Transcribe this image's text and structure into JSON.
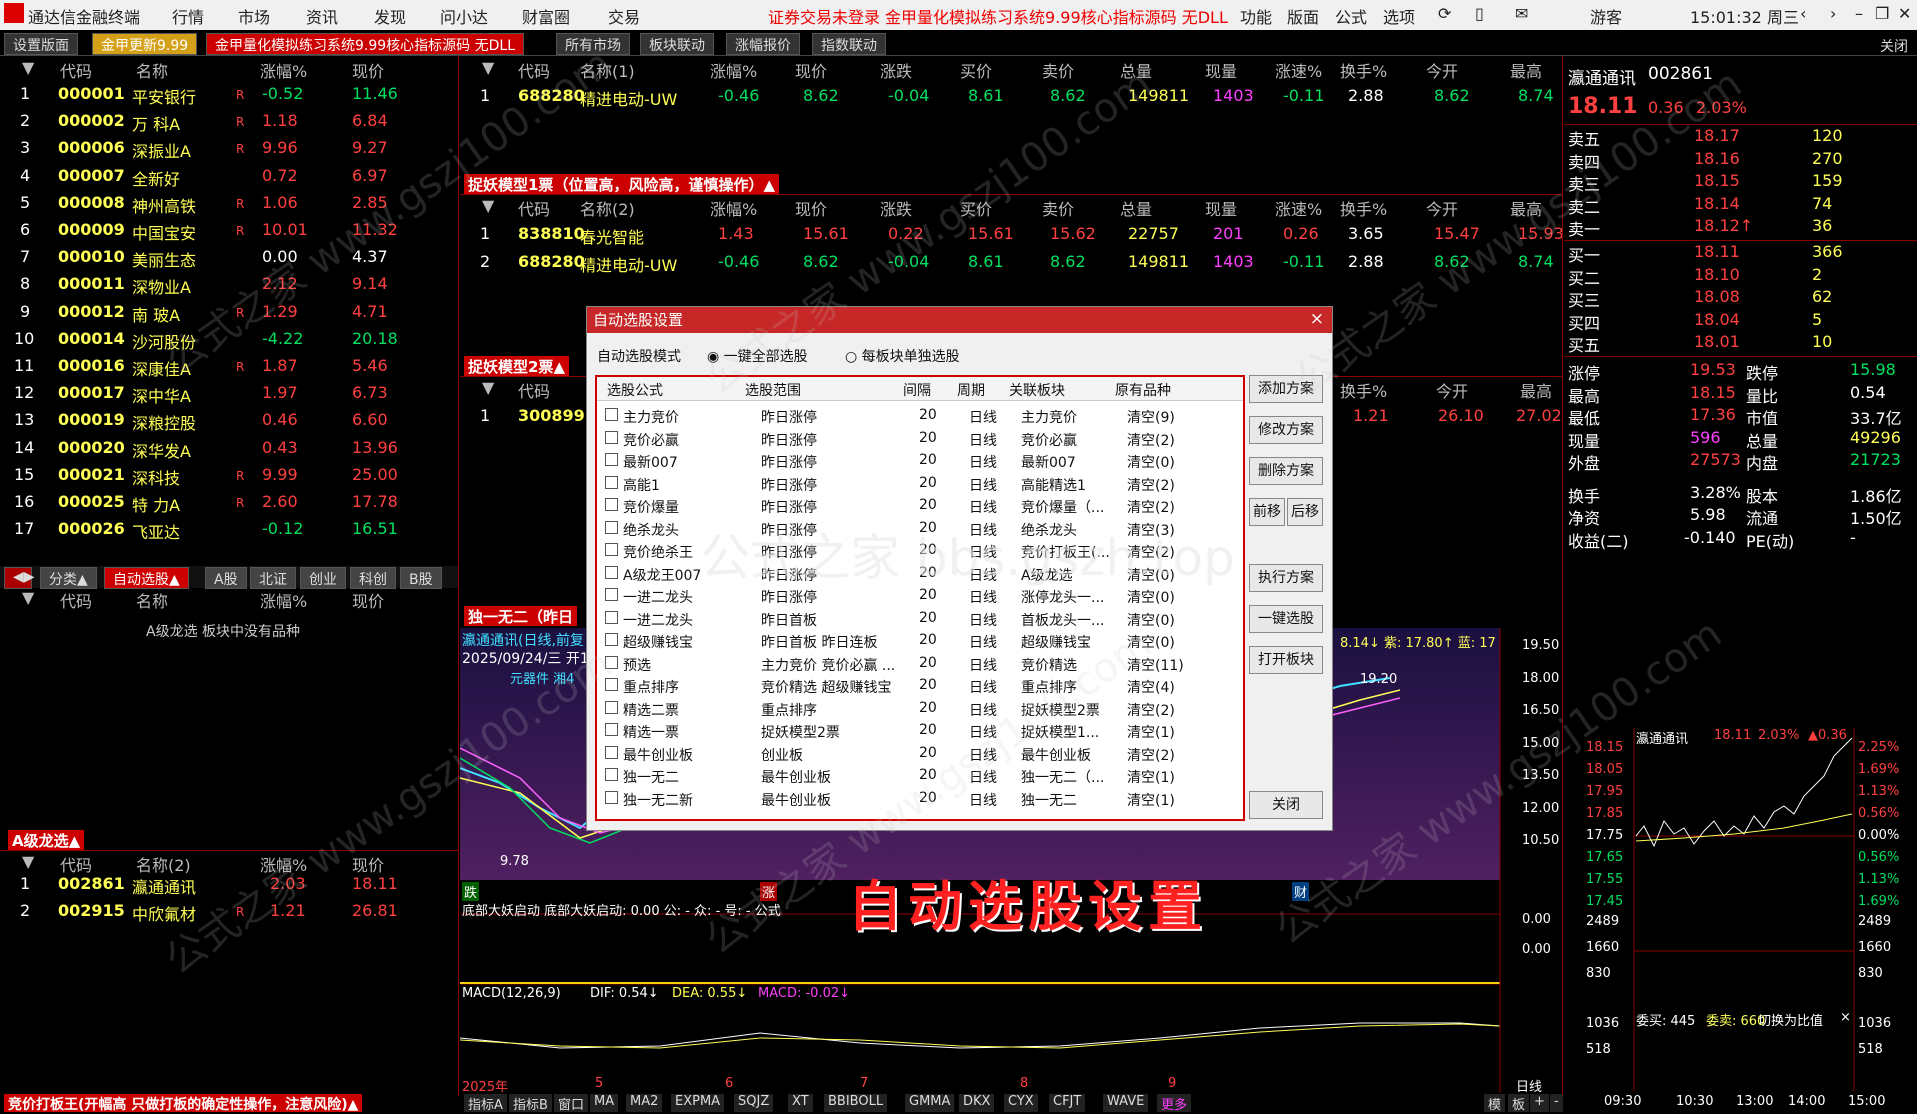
{
  "menubar": {
    "app": "通达信金融终端",
    "items": [
      "行情",
      "市场",
      "资讯",
      "发现",
      "问小达",
      "财富圈",
      "交易"
    ],
    "notice": "证券交易未登录",
    "promo": "金甲量化模拟练习系统9.99核心指标源码 无DLL",
    "right_items": [
      "功能",
      "版面",
      "公式",
      "选项"
    ],
    "user": "游客",
    "time": "15:01:32 周三"
  },
  "tabs": [
    "设置版面",
    "金甲更新9.99",
    "金甲量化模拟练习系统9.99核心指标源码 无DLL",
    "所有市场",
    "板块联动",
    "涨幅报价",
    "指数联动"
  ],
  "close_label": "关闭",
  "left_list": {
    "headers": [
      "代码",
      "名称",
      "涨幅%",
      "现价"
    ],
    "rows": [
      [
        "1",
        "000001",
        "平安银行",
        "R",
        "-0.52",
        "11.46"
      ],
      [
        "2",
        "000002",
        "万 科A",
        "R",
        "1.18",
        "6.84"
      ],
      [
        "3",
        "000006",
        "深振业A",
        "R",
        "9.96",
        "9.27"
      ],
      [
        "4",
        "000007",
        "全新好",
        "",
        "0.72",
        "6.97"
      ],
      [
        "5",
        "000008",
        "神州高铁",
        "R",
        "1.06",
        "2.85"
      ],
      [
        "6",
        "000009",
        "中国宝安",
        "R",
        "10.01",
        "11.32"
      ],
      [
        "7",
        "000010",
        "美丽生态",
        "",
        "0.00",
        "4.37"
      ],
      [
        "8",
        "000011",
        "深物业A",
        "",
        "2.12",
        "9.14"
      ],
      [
        "9",
        "000012",
        "南 玻A",
        "R",
        "1.29",
        "4.71"
      ],
      [
        "10",
        "000014",
        "沙河股份",
        "",
        "-4.22",
        "20.18"
      ],
      [
        "11",
        "000016",
        "深康佳A",
        "R",
        "1.87",
        "5.46"
      ],
      [
        "12",
        "000017",
        "深中华A",
        "",
        "1.97",
        "6.73"
      ],
      [
        "13",
        "000019",
        "深粮控股",
        "",
        "0.46",
        "6.60"
      ],
      [
        "14",
        "000020",
        "深华发A",
        "",
        "0.43",
        "13.96"
      ],
      [
        "15",
        "000021",
        "深科技",
        "R",
        "9.99",
        "25.00"
      ],
      [
        "16",
        "000025",
        "特 力A",
        "R",
        "2.60",
        "17.78"
      ],
      [
        "17",
        "000026",
        "飞亚达",
        "",
        "-0.12",
        "16.51"
      ]
    ]
  },
  "left_tabs": [
    "分类▲",
    "自动选股▲",
    "A股",
    "北证",
    "创业",
    "科创",
    "B股"
  ],
  "left_sub": {
    "headers": [
      "代码",
      "名称",
      "涨幅%",
      "现价"
    ],
    "empty": "A级龙选 板块中没有品种"
  },
  "a_section": {
    "title": "A级龙选▲",
    "headers": [
      "代码",
      "名称(2)",
      "涨幅%",
      "现价"
    ],
    "rows": [
      [
        "1",
        "002861",
        "瀛通通讯",
        "",
        "2.03",
        "18.11"
      ],
      [
        "2",
        "002915",
        "中欣氟材",
        "R",
        "1.21",
        "26.81"
      ]
    ]
  },
  "bottom_left": "竞价打板王(开幅高 只做打板的确定性操作，注意风险)▲",
  "top_table": {
    "headers": [
      "代码",
      "名称(1)",
      "涨幅%",
      "现价",
      "涨跌",
      "买价",
      "卖价",
      "总量",
      "现量",
      "涨速%",
      "换手%",
      "今开",
      "最高"
    ],
    "rows": [
      [
        "1",
        "688280",
        "精进电动-UW",
        "-0.46",
        "8.62",
        "-0.04",
        "8.61",
        "8.62",
        "149811",
        "1403",
        "-0.11",
        "2.88",
        "8.62",
        "8.74"
      ]
    ]
  },
  "model1": {
    "title": "捉妖模型1票（位置高，风险高，谨慎操作）▲",
    "headers": [
      "代码",
      "名称(2)",
      "涨幅%",
      "现价",
      "涨跌",
      "买价",
      "卖价",
      "总量",
      "现量",
      "涨速%",
      "换手%",
      "今开",
      "最高"
    ],
    "rows": [
      [
        "1",
        "838810",
        "春光智能",
        "1.43",
        "15.61",
        "0.22",
        "15.61",
        "15.62",
        "22757",
        "201",
        "0.26",
        "3.65",
        "15.47",
        "15.93"
      ],
      [
        "2",
        "688280",
        "精进电动-UW",
        "-0.46",
        "8.62",
        "-0.04",
        "8.61",
        "8.62",
        "149811",
        "1403",
        "-0.11",
        "2.88",
        "8.62",
        "8.74"
      ]
    ]
  },
  "model2": {
    "title": "捉妖模型2票▲",
    "headers": [
      "代码",
      "换手%",
      "今开",
      "最高"
    ],
    "rows": [
      [
        "1",
        "300899",
        "1.21",
        "26.10",
        "27.02"
      ]
    ]
  },
  "unique": {
    "title": "独一无二（昨日"
  },
  "chart_info": {
    "name": "瀛通通讯(日线,前复",
    "date": "2025/09/24/三 开1",
    "label1": "元器件 湘4",
    "ma_text": "8.14↓ 紫: 17.80↑ 蓝: 17",
    "price_hi": "19.20",
    "price_lo": "9.78",
    "axis": [
      "19.50",
      "18.00",
      "16.50",
      "15.00",
      "13.50",
      "12.00",
      "10.50"
    ],
    "marks": [
      "跌",
      "涨",
      "财"
    ]
  },
  "indicator1": {
    "text": "底部大妖启动 底部大妖启动: 0.00 公: - 众: - 号: - 公式",
    "axis": [
      "0.00",
      "0.00"
    ]
  },
  "macd": {
    "label": "MACD(12,26,9)",
    "dif": "DIF: 0.54↓",
    "dea": "DEA: 0.55↓",
    "macd": "MACD: -0.02↓"
  },
  "xaxis": {
    "labels": [
      "2025年",
      "5",
      "6",
      "7",
      "8",
      "9"
    ],
    "period": "日线"
  },
  "bottom_tabs": [
    "指标A",
    "指标B",
    "窗口",
    "MA",
    "MA2",
    "EXPMA",
    "SQJZ",
    "XT",
    "BBIBOLL",
    "GMMA",
    "DKX",
    "CYX",
    "CFJT",
    "WAVE",
    "更多"
  ],
  "bottom_right": [
    "模",
    "板",
    "+",
    "-",
    "0"
  ],
  "quote": {
    "name": "瀛通通讯",
    "code": "002861",
    "price": "18.11",
    "chg": "0.36",
    "pct": "2.03%",
    "asks": [
      [
        "卖五",
        "18.17",
        "120"
      ],
      [
        "卖四",
        "18.16",
        "270"
      ],
      [
        "卖三",
        "18.15",
        "159"
      ],
      [
        "卖二",
        "18.14",
        "74"
      ],
      [
        "卖一",
        "18.12↑",
        "36"
      ]
    ],
    "bids": [
      [
        "买一",
        "18.11",
        "366"
      ],
      [
        "买二",
        "18.10",
        "2"
      ],
      [
        "买三",
        "18.08",
        "62"
      ],
      [
        "买四",
        "18.04",
        "5"
      ],
      [
        "买五",
        "18.01",
        "10"
      ]
    ],
    "stats": [
      [
        "涨停",
        "19.53",
        "跌停",
        "15.98"
      ],
      [
        "最高",
        "18.15",
        "量比",
        "0.54"
      ],
      [
        "最低",
        "17.36",
        "市值",
        "33.7亿"
      ],
      [
        "现量",
        "596",
        "总量",
        "49296"
      ],
      [
        "外盘",
        "27573",
        "内盘",
        "21723"
      ],
      [
        "换手",
        "3.28%",
        "股本",
        "1.86亿"
      ],
      [
        "净资",
        "5.98",
        "流通",
        "1.50亿"
      ],
      [
        "收益(二)",
        "-0.140",
        "PE(动)",
        "-"
      ]
    ]
  },
  "intraday": {
    "title": "瀛通通讯",
    "price": "18.11",
    "pct": "2.03%",
    "chg": "▲0.36",
    "left_axis": [
      "18.15",
      "18.05",
      "17.95",
      "17.85",
      "17.75",
      "17.65",
      "17.55",
      "17.45",
      "2489",
      "1660",
      "830",
      "1036",
      "518"
    ],
    "right_axis": [
      "2.25%",
      "1.69%",
      "1.13%",
      "0.56%",
      "0.00%",
      "0.56%",
      "1.13%",
      "1.69%",
      "2489",
      "1660",
      "830",
      "1036",
      "518"
    ],
    "buy": "委买: 445",
    "sell": "委卖: 660",
    "switch": "切换为比值",
    "times": [
      "09:30",
      "10:30",
      "13:00",
      "14:00",
      "15:00"
    ]
  },
  "dialog": {
    "title": "自动选股设置",
    "mode_label": "自动选股模式",
    "opt1": "一键全部选股",
    "opt2": "每板块单独选股",
    "headers": [
      "选股公式",
      "选股范围",
      "间隔",
      "周期",
      "关联板块",
      "原有品种"
    ],
    "rows": [
      [
        "主力竞价",
        "昨日涨停",
        "20",
        "日线",
        "主力竞价",
        "清空(9)"
      ],
      [
        "竞价必赢",
        "昨日涨停",
        "20",
        "日线",
        "竞价必赢",
        "清空(2)"
      ],
      [
        "最新007",
        "昨日涨停",
        "20",
        "日线",
        "最新007",
        "清空(0)"
      ],
      [
        "高能1",
        "昨日涨停",
        "20",
        "日线",
        "高能精选1",
        "清空(2)"
      ],
      [
        "竞价爆量",
        "昨日涨停",
        "20",
        "日线",
        "竞价爆量（...",
        "清空(2)"
      ],
      [
        "绝杀龙头",
        "昨日涨停",
        "20",
        "日线",
        "绝杀龙头",
        "清空(3)"
      ],
      [
        "竞价绝杀王",
        "昨日涨停",
        "20",
        "日线",
        "竞价打板王(...",
        "清空(2)"
      ],
      [
        "A级龙王007",
        "昨日涨停",
        "20",
        "日线",
        "A级龙选",
        "清空(0)"
      ],
      [
        "一进二龙头",
        "昨日涨停",
        "20",
        "日线",
        "涨停龙头一...",
        "清空(0)"
      ],
      [
        "一进二龙头",
        "昨日首板",
        "20",
        "日线",
        "首板龙头一...",
        "清空(0)"
      ],
      [
        "超级赚钱宝",
        "昨日首板 昨日连板",
        "20",
        "日线",
        "超级赚钱宝",
        "清空(0)"
      ],
      [
        "预选",
        "主力竞价 竞价必赢 ...",
        "20",
        "日线",
        "竞价精选",
        "清空(11)"
      ],
      [
        "重点排序",
        "竞价精选 超级赚钱宝",
        "20",
        "日线",
        "重点排序",
        "清空(4)"
      ],
      [
        "精选二票",
        "重点排序",
        "20",
        "日线",
        "捉妖模型2票",
        "清空(2)"
      ],
      [
        "精选一票",
        "捉妖模型2票",
        "20",
        "日线",
        "捉妖模型1...",
        "清空(1)"
      ],
      [
        "最牛创业板",
        "创业板",
        "20",
        "日线",
        "最牛创业板",
        "清空(2)"
      ],
      [
        "独一无二",
        "最牛创业板",
        "20",
        "日线",
        "独一无二（...",
        "清空(1)"
      ],
      [
        "独一无二新",
        "最牛创业板",
        "20",
        "日线",
        "独一无二",
        "清空(1)"
      ]
    ],
    "buttons": [
      "添加方案",
      "修改方案",
      "删除方案",
      "前移",
      "后移",
      "执行方案",
      "一键选股",
      "打开板块",
      "关闭"
    ]
  },
  "caption": "自动选股设置",
  "watermark": "公式之家 bbs.gszh.top",
  "watermark_small": "公式之家 www.gszj100.com"
}
